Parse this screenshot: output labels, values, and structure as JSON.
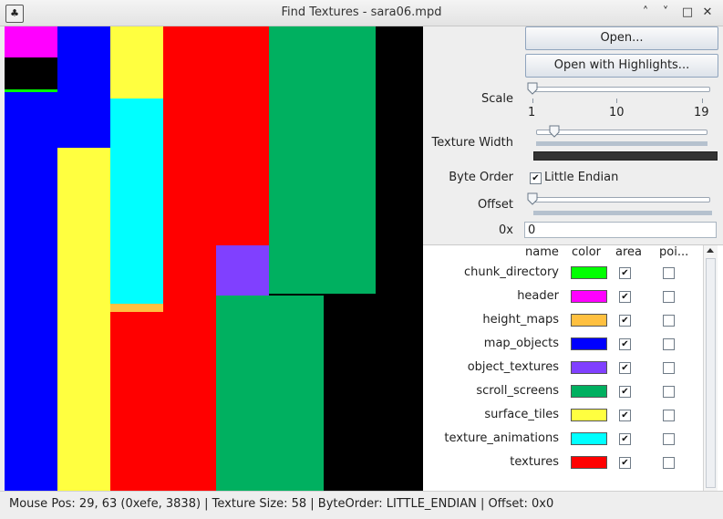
{
  "window": {
    "title": "Find Textures - sara06.mpd",
    "icon": "app-icon",
    "controls": [
      "minimize-icon",
      "maximize-icon",
      "restore-icon",
      "close-icon"
    ]
  },
  "buttons": {
    "open": "Open...",
    "open_highlights": "Open with Highlights..."
  },
  "scale": {
    "label": "Scale",
    "min_label": "1",
    "mid_label": "10",
    "max_label": "19",
    "value": 1
  },
  "texture_width": {
    "label": "Texture Width",
    "value": 58
  },
  "byte_order": {
    "label": "Byte Order",
    "checkbox_label": "Little Endian",
    "checked": true
  },
  "offset": {
    "label": "Offset",
    "hex_label": "0x",
    "value": "0"
  },
  "table": {
    "headers": {
      "name": "name",
      "color": "color",
      "area": "area",
      "poi": "poi..."
    },
    "rows": [
      {
        "name": "chunk_directory",
        "color": "#00ff00",
        "area": true,
        "poi": false
      },
      {
        "name": "header",
        "color": "#ff00ff",
        "area": true,
        "poi": false
      },
      {
        "name": "height_maps",
        "color": "#ffc040",
        "area": true,
        "poi": false
      },
      {
        "name": "map_objects",
        "color": "#0000ff",
        "area": true,
        "poi": false
      },
      {
        "name": "object_textures",
        "color": "#8040ff",
        "area": true,
        "poi": false
      },
      {
        "name": "scroll_screens",
        "color": "#00b060",
        "area": true,
        "poi": false
      },
      {
        "name": "surface_tiles",
        "color": "#ffff40",
        "area": true,
        "poi": false
      },
      {
        "name": "texture_animations",
        "color": "#00ffff",
        "area": true,
        "poi": false
      },
      {
        "name": "textures",
        "color": "#ff0000",
        "area": true,
        "poi": false
      }
    ]
  },
  "status": "Mouse Pos: 29, 63 (0xefe, 3838) | Texture Size: 58 | ByteOrder: LITTLE_ENDIAN | Offset: 0x0"
}
